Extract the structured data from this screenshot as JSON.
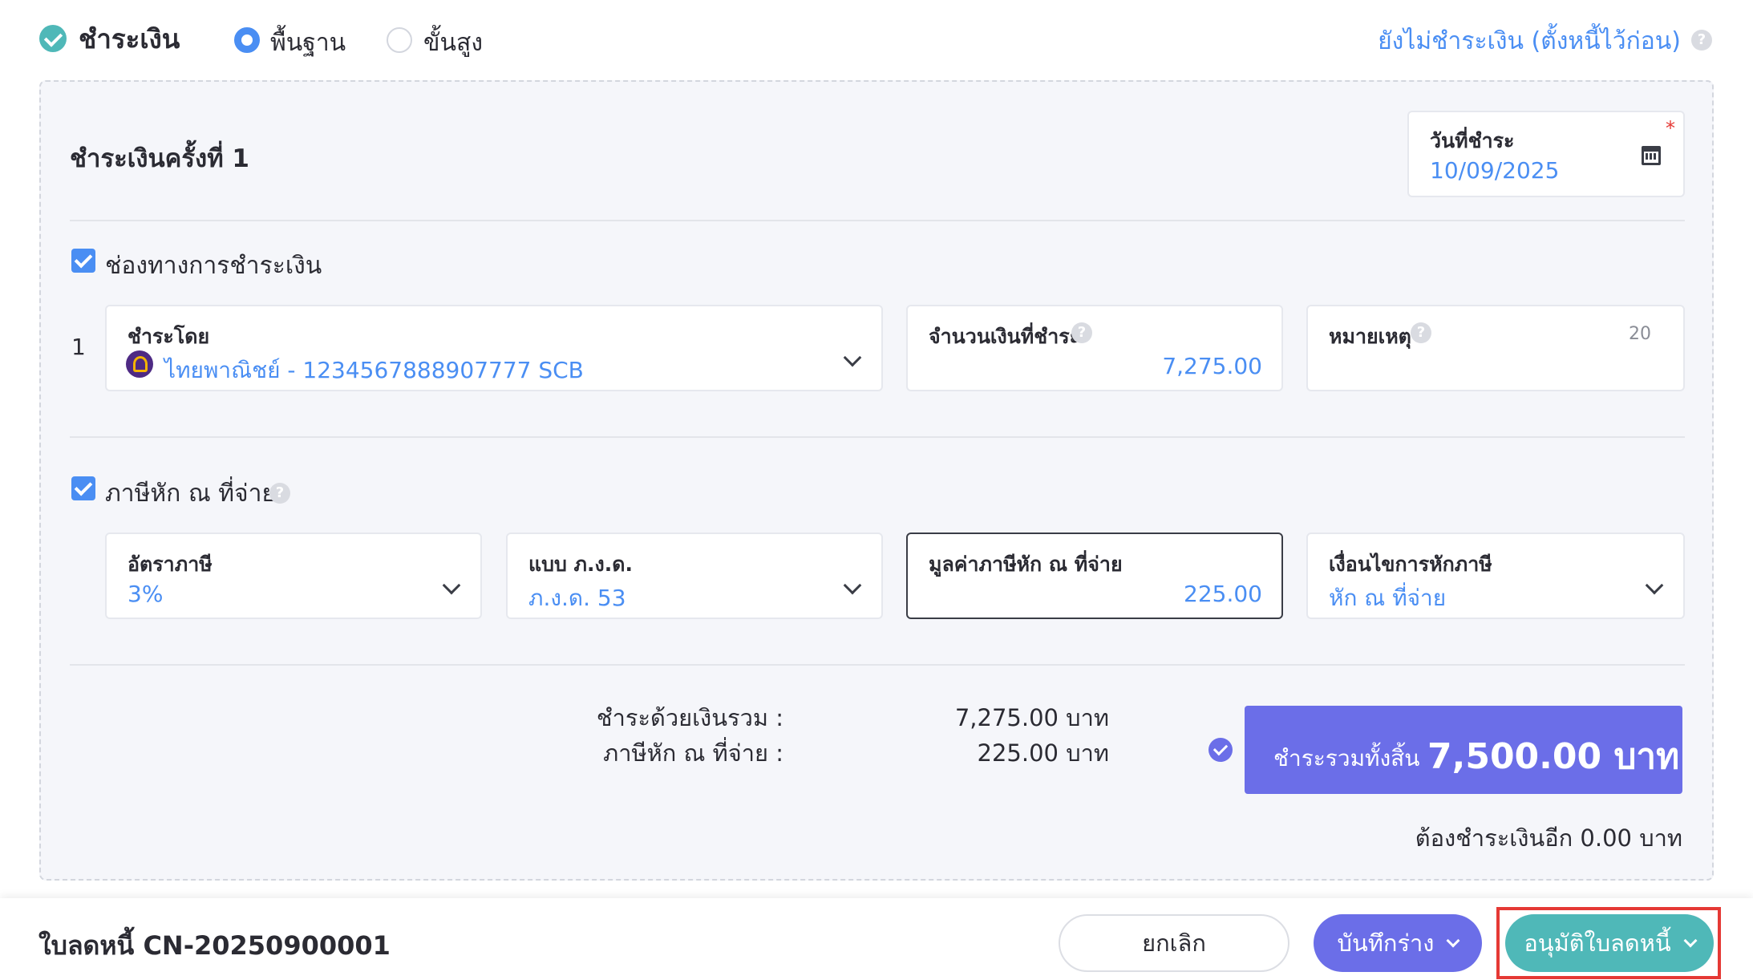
{
  "header": {
    "title": "ชำระเงิน",
    "mode_basic": "พื้นฐาน",
    "mode_advanced": "ขั้นสูง",
    "unpaid_link": "ยังไม่ชำระเงิน (ตั้งหนี้ไว้ก่อน)"
  },
  "payment": {
    "heading": "ชำระเงินครั้งที่ 1",
    "date_label": "วันที่ชำระ",
    "date_value": "10/09/2025",
    "channel_label": "ช่องทางการชำระเงิน",
    "row_number": "1",
    "paid_by_label": "ชำระโดย",
    "paid_by_value": "ไทยพาณิชย์ - 1234567888907777 SCB",
    "amount_label": "จำนวนเงินที่ชำระ",
    "amount_value": "7,275.00",
    "note_label": "หมายเหตุ",
    "note_counter": "20"
  },
  "withholding": {
    "label": "ภาษีหัก ณ ที่จ่าย",
    "rate_label": "อัตราภาษี",
    "rate_value": "3%",
    "form_label": "แบบ ภ.ง.ด.",
    "form_value": "ภ.ง.ด. 53",
    "tax_amount_label": "มูลค่าภาษีหัก ณ ที่จ่าย",
    "tax_amount_value": "225.00",
    "condition_label": "เงื่อนไขการหักภาษี",
    "condition_value": "หัก ณ ที่จ่าย"
  },
  "summary": {
    "cash_label": "ชำระด้วยเงินรวม :",
    "cash_value": "7,275.00 บาท",
    "wht_label": "ภาษีหัก ณ ที่จ่าย :",
    "wht_value": "225.00 บาท",
    "total_label": "ชำระรวมทั้งสิ้น",
    "total_value": "7,500.00 บาท",
    "remaining": "ต้องชำระเงินอีก 0.00 บาท"
  },
  "footer": {
    "doc_title": "ใบลดหนี้ CN-20250900001",
    "cancel_label": "ยกเลิก",
    "draft_label": "บันทึกร่าง",
    "approve_label": "อนุมัติใบลดหนี้"
  },
  "colors": {
    "accent_blue": "#4a8ef3",
    "accent_purple": "#6b6ee8",
    "accent_teal": "#4fb8b8",
    "highlight_red": "#e53935"
  },
  "icons": {
    "status": "check-circle-icon",
    "date": "calendar-icon",
    "help": "question-icon",
    "dropdown": "chevron-down-icon",
    "bank": "scb-bank-logo"
  }
}
